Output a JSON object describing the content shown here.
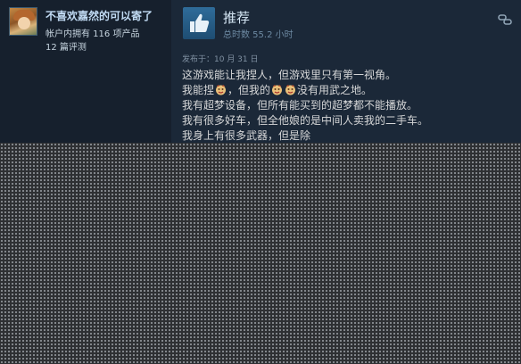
{
  "user": {
    "name": "不喜欢嘉然的可以寄了",
    "owned_products": "帐户内拥有 116 项产品",
    "review_count": "12 篇评测"
  },
  "review": {
    "verdict": "推荐",
    "hours": "总时数 55.2 小时",
    "posted": "发布于：10 月 31 日",
    "lines": [
      {
        "pre": "这游戏能让我捏人，但游戏里只有第一视角。",
        "mid": "",
        "post": ""
      },
      {
        "pre": "我能捏",
        "mid": "，但我的",
        "post": "没有用武之地。"
      },
      {
        "pre": "我有超梦设备，但所有能买到的超梦都不能播放。",
        "mid": "",
        "post": ""
      },
      {
        "pre": "我有很多好车，但全他娘的是中间人卖我的二手车。",
        "mid": "",
        "post": ""
      },
      {
        "pre": "我身上有很多武器，但是除",
        "mid": "",
        "post": ""
      }
    ]
  },
  "icons": {
    "thumb": "thumbs-up-icon",
    "corner": "link-icon",
    "emoji": "emoticon-icon"
  },
  "colors": {
    "background": "#16202d",
    "review_panel": "#1b2838",
    "username": "#c1dbf4",
    "verdict_box": "#2f6c9a"
  }
}
